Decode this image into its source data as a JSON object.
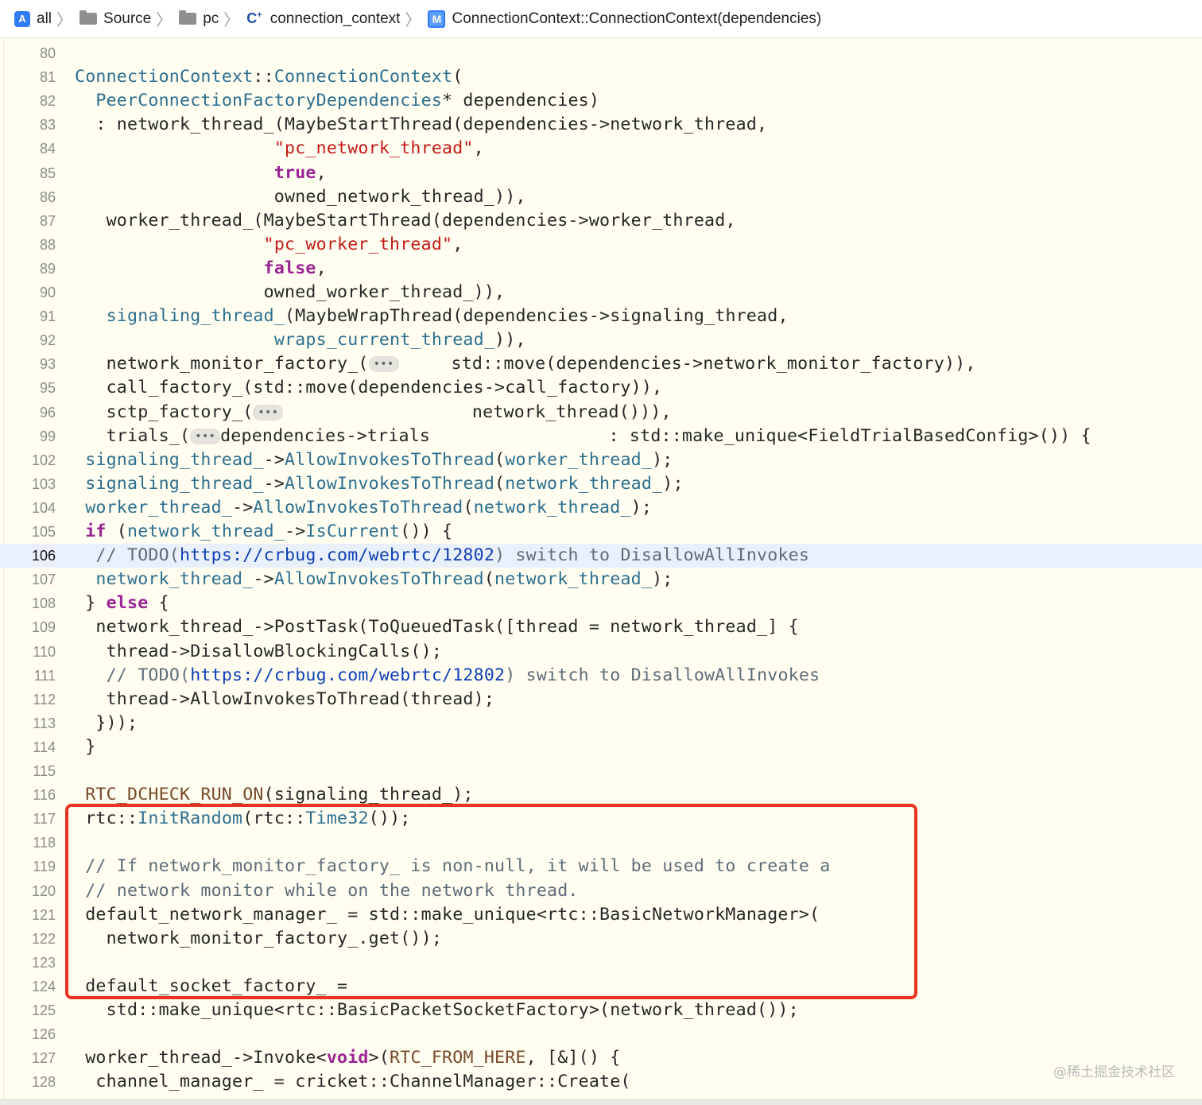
{
  "breadcrumb": {
    "items": [
      {
        "label": "all",
        "icon": "app-icon"
      },
      {
        "label": "Source",
        "icon": "folder-icon"
      },
      {
        "label": "pc",
        "icon": "folder-icon"
      },
      {
        "label": "connection_context",
        "icon": "cpp-file-icon"
      },
      {
        "label": "ConnectionContext::ConnectionContext(dependencies)",
        "icon": "method-icon"
      }
    ],
    "method_badge": "M"
  },
  "editor": {
    "current_line": "106",
    "fold_placeholder": "•••",
    "lines": [
      {
        "n": "80",
        "tokens": []
      },
      {
        "n": "81",
        "tokens": [
          {
            "c": "t-cls",
            "t": "ConnectionContext"
          },
          {
            "t": "::"
          },
          {
            "c": "t-cls",
            "t": "ConnectionContext"
          },
          {
            "t": "("
          }
        ]
      },
      {
        "n": "82",
        "tokens": [
          {
            "t": "  "
          },
          {
            "c": "t-cls",
            "t": "PeerConnectionFactoryDependencies"
          },
          {
            "t": "* dependencies)"
          }
        ]
      },
      {
        "n": "83",
        "tokens": [
          {
            "t": "  : network_thread_(MaybeStartThread(dependencies->network_thread,"
          }
        ]
      },
      {
        "n": "84",
        "tokens": [
          {
            "t": "                   "
          },
          {
            "c": "t-str",
            "t": "\"pc_network_thread\""
          },
          {
            "t": ","
          }
        ]
      },
      {
        "n": "85",
        "tokens": [
          {
            "t": "                   "
          },
          {
            "c": "t-kw",
            "t": "true"
          },
          {
            "t": ","
          }
        ]
      },
      {
        "n": "86",
        "tokens": [
          {
            "t": "                   owned_network_thread_)),"
          }
        ]
      },
      {
        "n": "87",
        "tokens": [
          {
            "t": "   worker_thread_(MaybeStartThread(dependencies->worker_thread,"
          }
        ]
      },
      {
        "n": "88",
        "tokens": [
          {
            "t": "                  "
          },
          {
            "c": "t-str",
            "t": "\"pc_worker_thread\""
          },
          {
            "t": ","
          }
        ]
      },
      {
        "n": "89",
        "tokens": [
          {
            "t": "                  "
          },
          {
            "c": "t-kw",
            "t": "false"
          },
          {
            "t": ","
          }
        ]
      },
      {
        "n": "90",
        "tokens": [
          {
            "t": "                  owned_worker_thread_)),"
          }
        ]
      },
      {
        "n": "91",
        "tokens": [
          {
            "t": "   "
          },
          {
            "c": "t-cls",
            "t": "signaling_thread_"
          },
          {
            "t": "(MaybeWrapThread(dependencies->signaling_thread,"
          }
        ]
      },
      {
        "n": "92",
        "tokens": [
          {
            "t": "                   "
          },
          {
            "c": "t-cls",
            "t": "wraps_current_thread_"
          },
          {
            "t": ")),"
          }
        ]
      },
      {
        "n": "93",
        "tokens": [
          {
            "t": "   network_monitor_factory_("
          },
          {
            "fold": true
          },
          {
            "t": "     std::move(dependencies->network_monitor_factory)),"
          }
        ]
      },
      {
        "n": "95",
        "tokens": [
          {
            "t": "   call_factory_(std::move(dependencies->call_factory)),"
          }
        ]
      },
      {
        "n": "96",
        "tokens": [
          {
            "t": "   sctp_factory_("
          },
          {
            "fold": true
          },
          {
            "t": "                  network_thread())),"
          }
        ]
      },
      {
        "n": "99",
        "tokens": [
          {
            "t": "   trials_("
          },
          {
            "fold": true
          },
          {
            "t": "dependencies->trials                 : std::make_unique<FieldTrialBasedConfig>()) {"
          }
        ]
      },
      {
        "n": "102",
        "tokens": [
          {
            "t": " "
          },
          {
            "c": "t-cls",
            "t": "signaling_thread_"
          },
          {
            "t": "->"
          },
          {
            "c": "t-cls",
            "t": "AllowInvokesToThread"
          },
          {
            "t": "("
          },
          {
            "c": "t-cls",
            "t": "worker_thread_"
          },
          {
            "t": ");"
          }
        ]
      },
      {
        "n": "103",
        "tokens": [
          {
            "t": " "
          },
          {
            "c": "t-cls",
            "t": "signaling_thread_"
          },
          {
            "t": "->"
          },
          {
            "c": "t-cls",
            "t": "AllowInvokesToThread"
          },
          {
            "t": "("
          },
          {
            "c": "t-cls",
            "t": "network_thread_"
          },
          {
            "t": ");"
          }
        ]
      },
      {
        "n": "104",
        "tokens": [
          {
            "t": " "
          },
          {
            "c": "t-cls",
            "t": "worker_thread_"
          },
          {
            "t": "->"
          },
          {
            "c": "t-cls",
            "t": "AllowInvokesToThread"
          },
          {
            "t": "("
          },
          {
            "c": "t-cls",
            "t": "network_thread_"
          },
          {
            "t": ");"
          }
        ]
      },
      {
        "n": "105",
        "tokens": [
          {
            "t": " "
          },
          {
            "c": "t-kw",
            "t": "if"
          },
          {
            "t": " ("
          },
          {
            "c": "t-cls",
            "t": "network_thread_"
          },
          {
            "t": "->"
          },
          {
            "c": "t-cls",
            "t": "IsCurrent"
          },
          {
            "t": "()) {"
          }
        ]
      },
      {
        "n": "106",
        "tokens": [
          {
            "t": "  "
          },
          {
            "c": "t-cm",
            "t": "// TODO("
          },
          {
            "c": "t-url",
            "t": "https://crbug.com/webrtc/12802"
          },
          {
            "c": "t-cm",
            "t": ") switch to DisallowAllInvokes"
          }
        ]
      },
      {
        "n": "107",
        "tokens": [
          {
            "t": "  "
          },
          {
            "c": "t-cls",
            "t": "network_thread_"
          },
          {
            "t": "->"
          },
          {
            "c": "t-cls",
            "t": "AllowInvokesToThread"
          },
          {
            "t": "("
          },
          {
            "c": "t-cls",
            "t": "network_thread_"
          },
          {
            "t": ");"
          }
        ]
      },
      {
        "n": "108",
        "tokens": [
          {
            "t": " } "
          },
          {
            "c": "t-kw",
            "t": "else"
          },
          {
            "t": " {"
          }
        ]
      },
      {
        "n": "109",
        "tokens": [
          {
            "t": "  network_thread_->PostTask(ToQueuedTask([thread = network_thread_] {"
          }
        ]
      },
      {
        "n": "110",
        "tokens": [
          {
            "t": "   thread->DisallowBlockingCalls();"
          }
        ]
      },
      {
        "n": "111",
        "tokens": [
          {
            "t": "   "
          },
          {
            "c": "t-cm",
            "t": "// TODO("
          },
          {
            "c": "t-url",
            "t": "https://crbug.com/webrtc/12802"
          },
          {
            "c": "t-cm",
            "t": ") switch to DisallowAllInvokes"
          }
        ]
      },
      {
        "n": "112",
        "tokens": [
          {
            "t": "   thread->AllowInvokesToThread(thread);"
          }
        ]
      },
      {
        "n": "113",
        "tokens": [
          {
            "t": "  }));"
          }
        ]
      },
      {
        "n": "114",
        "tokens": [
          {
            "t": " }"
          }
        ]
      },
      {
        "n": "115",
        "tokens": []
      },
      {
        "n": "116",
        "tokens": [
          {
            "t": " "
          },
          {
            "c": "t-mac",
            "t": "RTC_DCHECK_RUN_ON"
          },
          {
            "t": "(signaling_thread_);"
          }
        ]
      },
      {
        "n": "117",
        "tokens": [
          {
            "t": " rtc::"
          },
          {
            "c": "t-cls",
            "t": "InitRandom"
          },
          {
            "t": "(rtc::"
          },
          {
            "c": "t-cls",
            "t": "Time32"
          },
          {
            "t": "());"
          }
        ]
      },
      {
        "n": "118",
        "tokens": []
      },
      {
        "n": "119",
        "tokens": [
          {
            "t": " "
          },
          {
            "c": "t-cm",
            "t": "// If network_monitor_factory_ is non-null, it will be used to create a"
          }
        ]
      },
      {
        "n": "120",
        "tokens": [
          {
            "t": " "
          },
          {
            "c": "t-cm",
            "t": "// network monitor while on the network thread."
          }
        ]
      },
      {
        "n": "121",
        "tokens": [
          {
            "t": " default_network_manager_ = std::make_unique<rtc::BasicNetworkManager>("
          }
        ]
      },
      {
        "n": "122",
        "tokens": [
          {
            "t": "   network_monitor_factory_.get());"
          }
        ]
      },
      {
        "n": "123",
        "tokens": []
      },
      {
        "n": "124",
        "tokens": [
          {
            "t": " default_socket_factory_ ="
          }
        ]
      },
      {
        "n": "125",
        "tokens": [
          {
            "t": "   std::make_unique<rtc::BasicPacketSocketFactory>(network_thread());"
          }
        ]
      },
      {
        "n": "126",
        "tokens": []
      },
      {
        "n": "127",
        "tokens": [
          {
            "t": " worker_thread_->Invoke<"
          },
          {
            "c": "t-kw",
            "t": "void"
          },
          {
            "t": ">("
          },
          {
            "c": "t-mac",
            "t": "RTC_FROM_HERE"
          },
          {
            "t": ", [&]() {"
          }
        ]
      },
      {
        "n": "128",
        "tokens": [
          {
            "t": "  channel_manager_ = cricket::ChannelManager::Create("
          }
        ]
      }
    ]
  },
  "watermark": "@稀土掘金技术社区",
  "colors": {
    "highlight_box": "#e8331f",
    "background": "#fffef1",
    "current_line": "#eaf0fb"
  }
}
